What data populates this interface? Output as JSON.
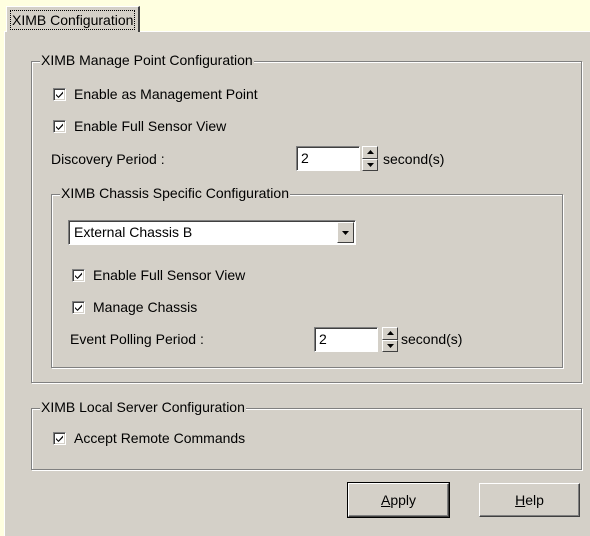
{
  "tab": {
    "label": "XIMB Configuration"
  },
  "manage_point": {
    "legend": "XIMB Manage Point Configuration",
    "enable_mgmt_point": {
      "label": "Enable as Management Point",
      "checked": true
    },
    "enable_full_sensor": {
      "label": "Enable Full Sensor View",
      "checked": true
    },
    "discovery": {
      "label": "Discovery Period :",
      "value": "2",
      "unit": "second(s)"
    },
    "chassis": {
      "legend": "XIMB Chassis Specific Configuration",
      "selected": "External Chassis B",
      "enable_full_sensor": {
        "label": "Enable Full Sensor View",
        "checked": true
      },
      "manage_chassis": {
        "label": "Manage Chassis",
        "checked": true
      },
      "event_polling": {
        "label": "Event Polling Period :",
        "value": "2",
        "unit": "second(s)"
      }
    }
  },
  "local_server": {
    "legend": "XIMB Local Server Configuration",
    "accept_remote": {
      "label": "Accept Remote Commands",
      "checked": true
    }
  },
  "buttons": {
    "apply_prefix": "",
    "apply_mnemonic": "A",
    "apply_rest": "pply",
    "help_prefix": "",
    "help_mnemonic": "H",
    "help_rest": "elp"
  },
  "icons": {
    "check": "check-icon",
    "spin_up": "up-arrow-icon",
    "spin_down": "down-arrow-icon",
    "dropdown": "dropdown-arrow-icon"
  },
  "colors": {
    "background": "#ffffe0",
    "face": "#d4d0c8"
  }
}
